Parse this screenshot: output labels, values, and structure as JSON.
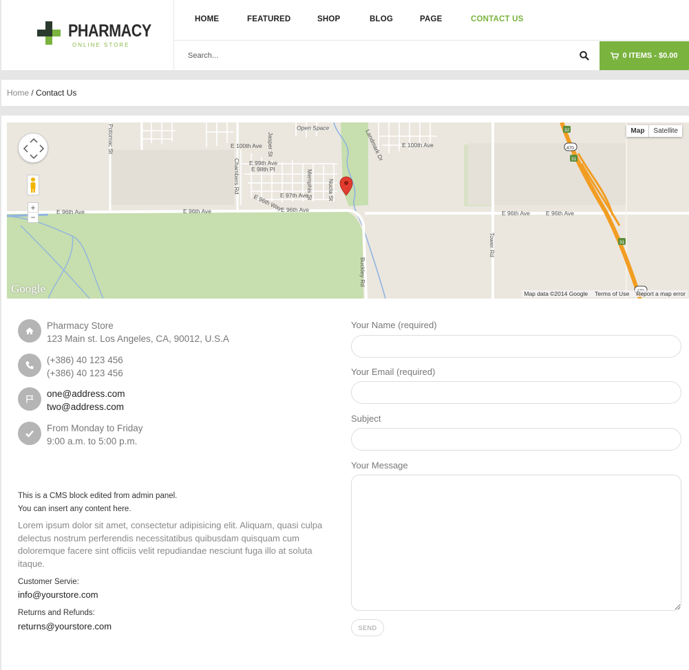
{
  "logo": {
    "title": "PHARMACY",
    "subtitle": "ONLINE STORE"
  },
  "nav": [
    "HOME",
    "FEATURED",
    "SHOP",
    "BLOG",
    "PAGE",
    "CONTACT US"
  ],
  "nav_active": "CONTACT US",
  "search": {
    "placeholder": "Search..."
  },
  "cart": {
    "label": "0 ITEMS - $0.00"
  },
  "breadcrumb": {
    "home": "Home",
    "separator": " / ",
    "current": "Contact Us"
  },
  "map": {
    "type_tabs": [
      "Map",
      "Satellite"
    ],
    "attribution": "Map data ©2014 Google",
    "terms": "Terms of Use",
    "report": "Report a map error",
    "logo_text": "Google",
    "zoom_in": "+",
    "zoom_out": "−",
    "labels": [
      "E 96th Ave",
      "E 96th Ave",
      "E 96th Ave",
      "E 96th Ave",
      "E 96th Ave",
      "E 100th Ave",
      "E 100th Ave",
      "E 99th Ave",
      "E 98th Pl",
      "E 97th Ave",
      "E 96th Way",
      "Open Space",
      "Chambers Rd",
      "Jasper St",
      "Memphis St",
      "Nucla St",
      "Landmark Dr",
      "Tower Rd",
      "Buckley Rd",
      "Potomac St",
      "470",
      "32",
      "31",
      "31",
      "470"
    ]
  },
  "contact": {
    "address": {
      "name": "Pharmacy Store",
      "line": "123 Main st. Los Angeles, CA, 90012, U.S.A"
    },
    "phones": [
      "(+386) 40 123 456",
      "(+386) 40 123 456"
    ],
    "emails": [
      "one@address.com",
      "two@address.com"
    ],
    "hours": [
      "From Monday to Friday",
      "9:00 a.m. to 5:00 p.m."
    ]
  },
  "cms": {
    "line1": "This is a CMS block edited from admin panel.",
    "line2": "You can insert any content here.",
    "lorem": "Lorem ipsum dolor sit amet, consectetur adipisicing elit. Aliquam, quasi culpa delectus nostrum perferendis necessitatibus quibusdam quisquam cum doloremque facere sint officiis velit repudiandae nesciunt fuga illo at soluta itaque.",
    "cs_label": "Customer Servie:",
    "cs_email": "info@yourstore.com",
    "rr_label": "Returns and Refunds:",
    "rr_email": "returns@yourstore.com"
  },
  "form": {
    "name_label": "Your Name (required)",
    "email_label": "Your Email (required)",
    "subject_label": "Subject",
    "message_label": "Your Message",
    "send_label": "SEND"
  },
  "colors": {
    "accent": "#7ab33e",
    "icon_gray": "#b5b5b5",
    "dark_cross": "#2b3a2e"
  }
}
